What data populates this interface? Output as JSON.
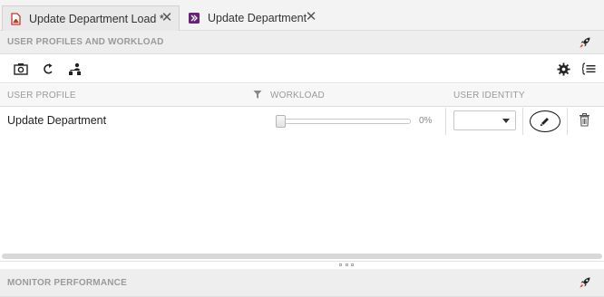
{
  "tabs": [
    {
      "label": "Update Department Load *",
      "icon": "document-load-icon",
      "active": true
    },
    {
      "label": "Update Department",
      "icon": "vs-project-icon",
      "active": false
    }
  ],
  "profiles_section": {
    "title": "USER PROFILES AND WORKLOAD",
    "pin_icon": "rocket-pin-icon"
  },
  "toolbar": {
    "left_icons": [
      "camera-icon",
      "refresh-arrow-icon",
      "user-hierarchy-icon"
    ],
    "right_icons": [
      "gear-icon",
      "list-options-icon"
    ]
  },
  "columns": {
    "user_profile": "USER PROFILE",
    "workload": "WORKLOAD",
    "user_identity": "USER IDENTITY"
  },
  "rows": [
    {
      "name": "Update Department",
      "workload_fraction": 0.0,
      "workload_label": "0%",
      "identity_value": ""
    }
  ],
  "monitor_section": {
    "title": "MONITOR PERFORMANCE",
    "pin_icon": "rocket-pin-icon"
  },
  "colors": {
    "accent_red": "#c0392b",
    "accent_purple": "#68217a",
    "header_text": "#9a9a9a"
  }
}
